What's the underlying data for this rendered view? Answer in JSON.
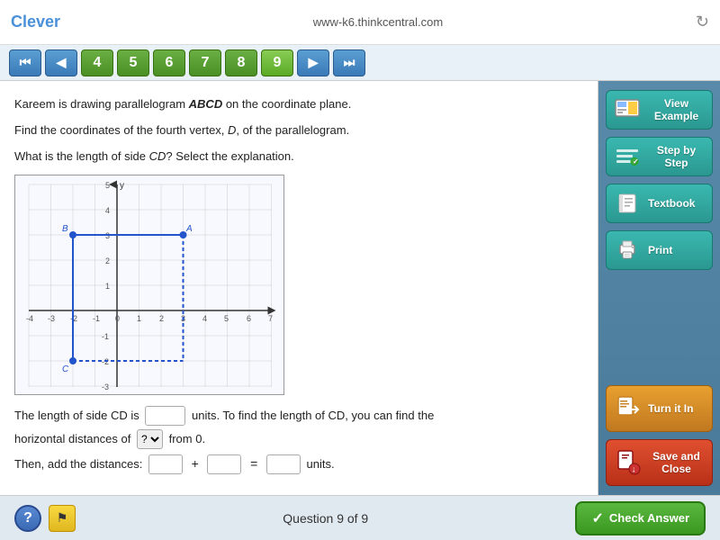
{
  "topbar": {
    "logo": "Clever",
    "url": "www-k6.thinkcentral.com",
    "refresh_label": "↻"
  },
  "nav": {
    "prev_prev": "⏮",
    "prev": "◀",
    "numbers": [
      "4",
      "5",
      "6",
      "7",
      "8",
      "9"
    ],
    "next": "▶",
    "next_next": "⏭"
  },
  "question": {
    "line1": "Kareem is drawing parallelogram ABCD on the coordinate plane.",
    "line2": "Find the coordinates of the fourth vertex, D, of the parallelogram.",
    "line3": "What is the length of side CD? Select the explanation.",
    "answer_line1_pre": "The length of side CD is",
    "answer_line1_mid": "units. To find the length of CD, you can find the",
    "answer_line2_pre": "horizontal distances of",
    "answer_line2_mid": "from 0.",
    "answer_line3_pre": "Then, add the distances:",
    "answer_line3_plus": "+",
    "answer_line3_eq": "=",
    "answer_line3_post": "units."
  },
  "tools": {
    "view_example": "View Example",
    "step_by_step": "Step by Step",
    "textbook": "Textbook",
    "print": "Print"
  },
  "actions": {
    "turn_it_in": "Turn it In",
    "save_and_close": "Save and Close"
  },
  "bottom": {
    "help_label": "?",
    "flag_label": "⚑",
    "question_counter": "Question 9 of 9",
    "check_answer": "Check Answer"
  }
}
